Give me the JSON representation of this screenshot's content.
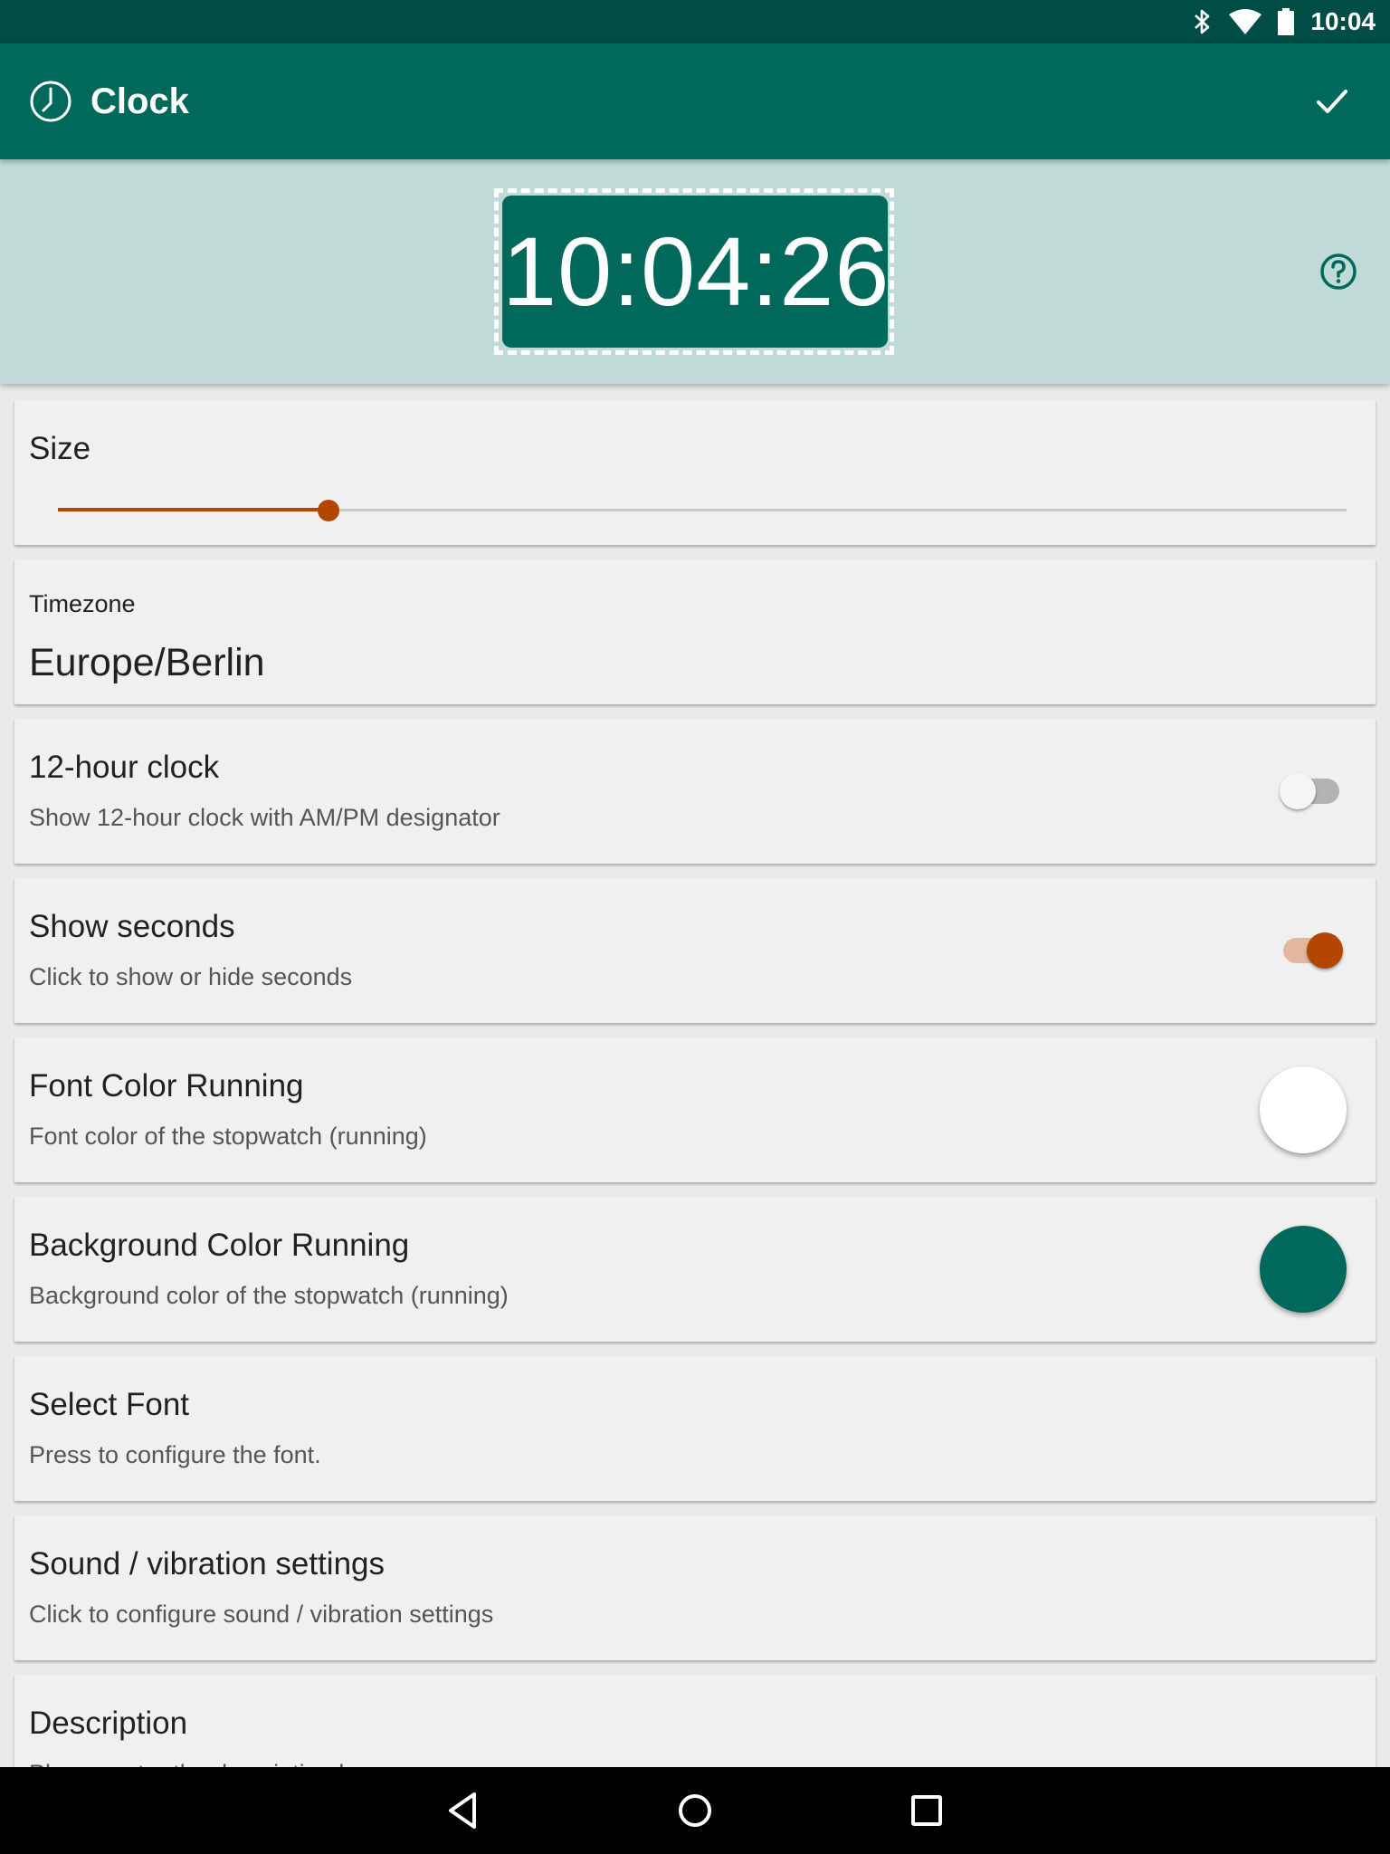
{
  "status_bar": {
    "time": "10:04",
    "icons": [
      "bluetooth-icon",
      "wifi-icon",
      "battery-icon"
    ]
  },
  "app_bar": {
    "title": "Clock",
    "icon": "clock-icon",
    "action_icon": "checkmark-icon"
  },
  "preview": {
    "clock_time": "10:04:26",
    "help_icon": "help-icon"
  },
  "settings": {
    "size": {
      "title": "Size",
      "level": 0.21
    },
    "timezone": {
      "label": "Timezone",
      "value": "Europe/Berlin"
    },
    "twelve_hour": {
      "title": "12-hour clock",
      "summary": "Show 12-hour clock with AM/PM designator",
      "enabled": false
    },
    "show_seconds": {
      "title": "Show seconds",
      "summary": "Click to show or hide seconds",
      "enabled": true
    },
    "font_color": {
      "title": "Font Color Running",
      "summary": "Font color of the stopwatch (running)",
      "color": "#ffffff"
    },
    "background_color": {
      "title": "Background Color Running",
      "summary": "Background color of the stopwatch (running)",
      "color": "#00695c"
    },
    "select_font": {
      "title": "Select Font",
      "summary": "Press to configure the font."
    },
    "sound": {
      "title": "Sound / vibration settings",
      "summary": "Click to configure sound / vibration settings"
    },
    "description": {
      "title": "Description",
      "summary": "Please enter the description here"
    }
  },
  "colors": {
    "primary": "#00695c",
    "primary_dark": "#004d45",
    "accent": "#b34700",
    "preview_background": "#c0dbd7"
  },
  "nav_bar": {
    "icons": [
      "back-icon",
      "home-icon",
      "recents-icon"
    ]
  }
}
